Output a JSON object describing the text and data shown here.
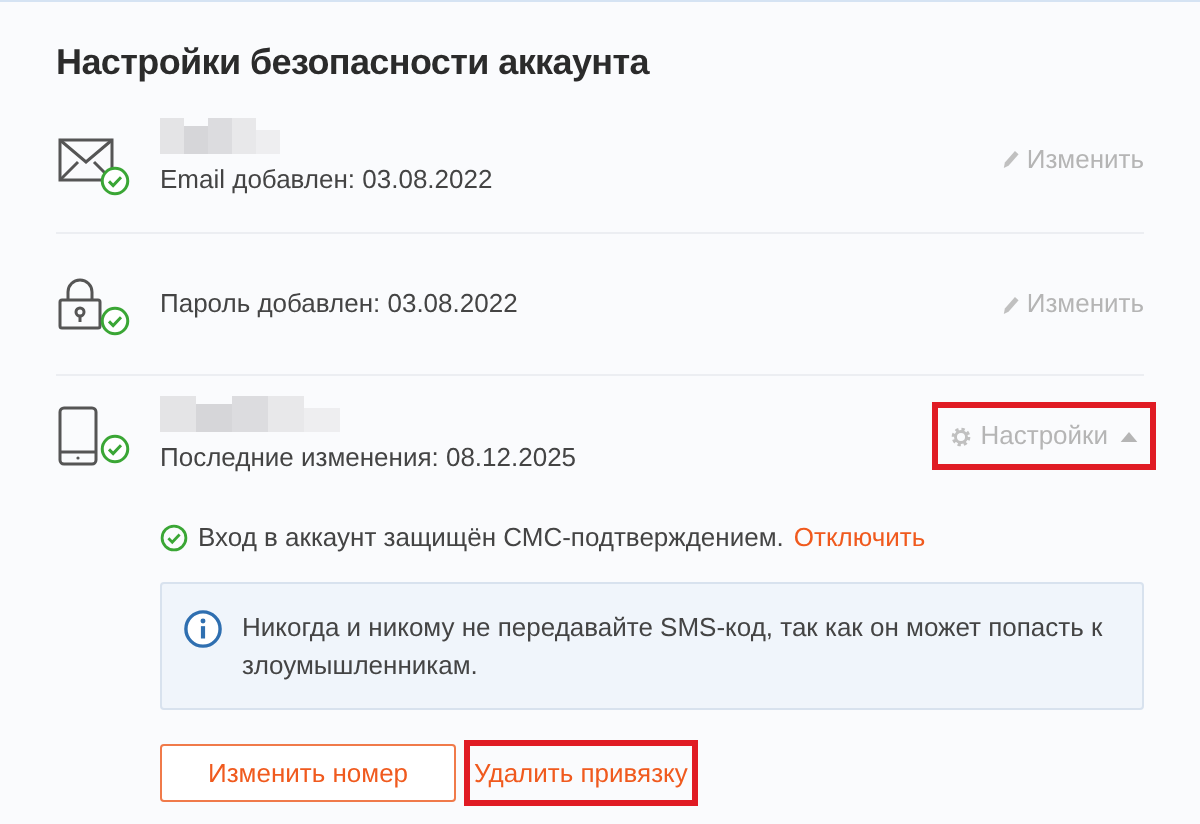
{
  "title": "Настройки безопасности аккаунта",
  "items": [
    {
      "kind": "email",
      "redacted": true,
      "verified": true,
      "caption": "Email добавлен: 03.08.2022",
      "action": {
        "kind": "edit",
        "label": "Изменить"
      }
    },
    {
      "kind": "password",
      "redacted": false,
      "verified": true,
      "caption": "Пароль добавлен: 03.08.2022",
      "action": {
        "kind": "edit",
        "label": "Изменить"
      }
    },
    {
      "kind": "phone",
      "redacted": true,
      "verified": true,
      "caption": "Последние изменения: 08.12.2025",
      "action": {
        "kind": "settings",
        "label": "Настройки",
        "expanded": true,
        "highlighted": true
      },
      "details": {
        "status": "Вход в аккаунт защищён СМС-подтверждением.",
        "status_link": "Отключить",
        "notice": "Никогда и никому не передавайте SMS-код, так как он может попасть к злоумышленникам.",
        "buttons": [
          {
            "kind": "outline",
            "label": "Изменить номер",
            "highlighted": false
          },
          {
            "kind": "text",
            "label": "Удалить привязку",
            "highlighted": true
          }
        ]
      }
    }
  ]
}
